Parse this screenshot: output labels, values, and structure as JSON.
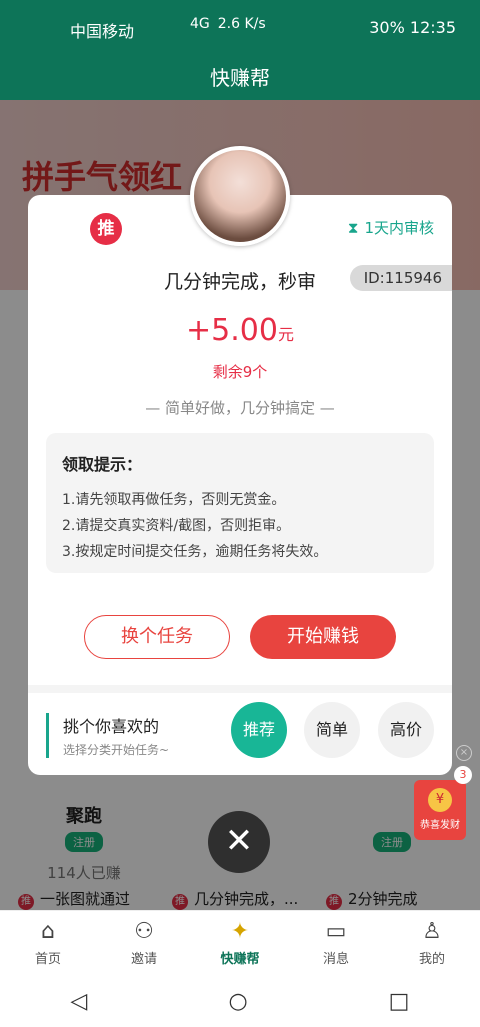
{
  "status_bar": {
    "carrier": "中国移动",
    "network": "4G",
    "speed": "2.6 K/s",
    "battery": "30%",
    "time": "12:35"
  },
  "header": {
    "title": "快赚帮"
  },
  "banner": {
    "text": "拼手气领红"
  },
  "cards": [
    {
      "name": "聚跑",
      "badge": "注册",
      "count": "114人已赚",
      "tag": "推",
      "desc": "一张图就通过"
    },
    {
      "name": "",
      "badge": "",
      "count": "",
      "tag": "推",
      "desc": "几分钟完成，..."
    },
    {
      "name": "",
      "badge": "注册",
      "count": "",
      "tag": "推",
      "desc": "2分钟完成"
    }
  ],
  "modal": {
    "tag": "推",
    "review": "1天内审核",
    "title": "几分钟完成，秒审",
    "id": "ID:115946",
    "price": "+5.00",
    "unit": "元",
    "remain": "剩余9个",
    "slogan": "— 简单好做，几分钟搞定 —",
    "tips_title": "领取提示：",
    "tips": [
      "1.请先领取再做任务，否则无赏金。",
      "2.请提交真实资料/截图，否则拒审。",
      "3.按规定时间提交任务，逾期任务将失效。"
    ],
    "btn_swap": "换个任务",
    "btn_start": "开始赚钱",
    "pick_title": "挑个你喜欢的",
    "pick_sub": "选择分类开始任务~",
    "categories": [
      "推荐",
      "简单",
      "高价"
    ]
  },
  "redpack": {
    "count": "3",
    "label": "恭喜发财",
    "coin": "¥"
  },
  "nav": [
    {
      "label": "首页",
      "icon": "home-icon"
    },
    {
      "label": "邀请",
      "icon": "people-icon"
    },
    {
      "label": "快赚帮",
      "icon": "logo-icon"
    },
    {
      "label": "消息",
      "icon": "message-icon"
    },
    {
      "label": "我的",
      "icon": "user-icon"
    }
  ]
}
